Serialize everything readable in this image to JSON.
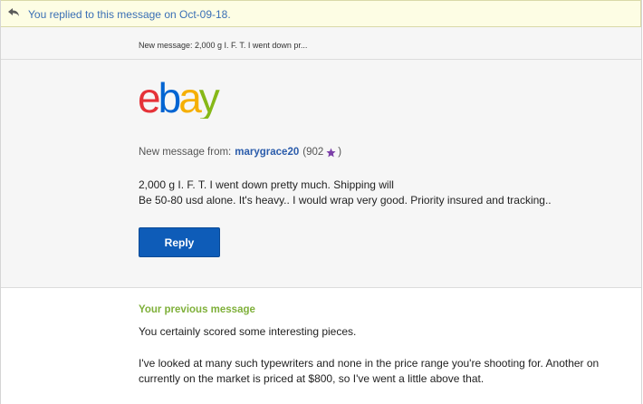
{
  "banner": {
    "icon": "reply-arrow-icon",
    "text": "You replied to this message on Oct-09-18."
  },
  "preview": {
    "text": "New message: 2,000 g I. F. T. I went down pr..."
  },
  "message": {
    "logo_text": "ebay",
    "from_label": "New message from:",
    "username": "marygrace20",
    "feedback_open": "(902",
    "feedback_close": ")",
    "star_icon": "purple-star-icon",
    "body_line1": "2,000 g I. F. T. I went down pretty much. Shipping will",
    "body_line2": "Be 50-80 usd alone. It's heavy.. I would wrap very good. Priority insured and tracking..",
    "reply_label": "Reply"
  },
  "previous": {
    "heading": "Your previous message",
    "p1": "You certainly scored some interesting pieces.",
    "p2": "I've looked at many such typewriters and none in the price range you're shooting for. Another on currently on the market is priced at $800, so I've went a little above that."
  },
  "colors": {
    "banner_bg": "#fdfde4",
    "link_blue": "#2b5cab",
    "button_blue": "#0e5cb8",
    "heading_green": "#7fb03a",
    "ebay_red": "#e53238",
    "ebay_blue": "#0064d2",
    "ebay_yellow": "#f5af02",
    "ebay_green": "#86b817"
  }
}
